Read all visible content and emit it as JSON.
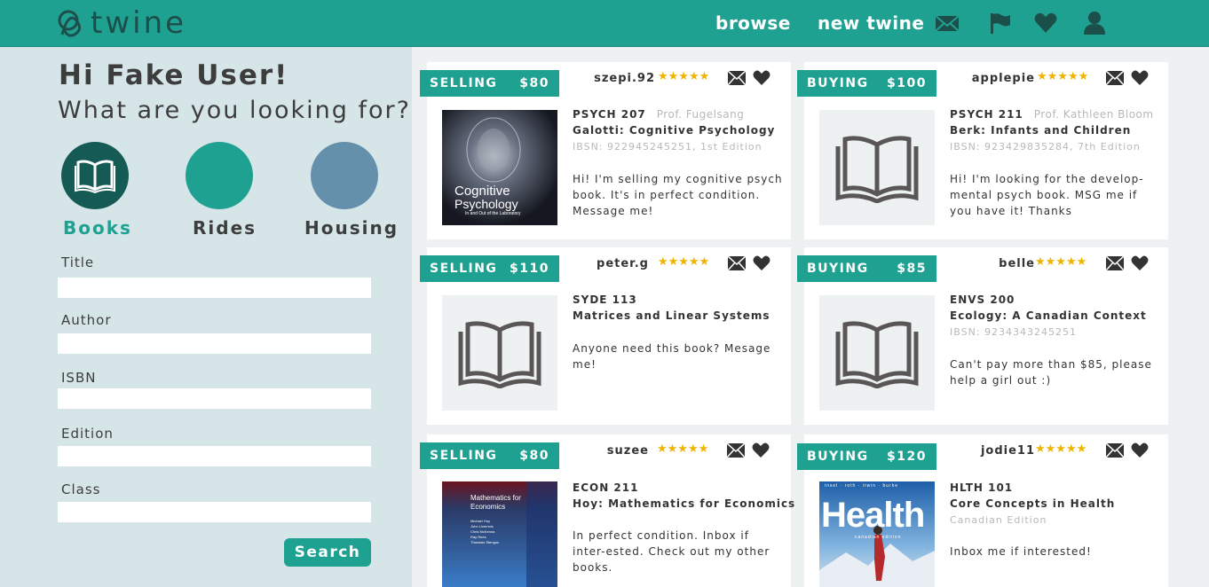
{
  "header": {
    "logo_text": "twine",
    "nav": {
      "browse": "browse",
      "new_twine": "new twine"
    },
    "icons": [
      "mail-icon",
      "flag-icon",
      "heart-icon",
      "user-icon"
    ]
  },
  "sidebar": {
    "greeting": "Hi Fake User!",
    "question": "What are you looking for?",
    "categories": [
      {
        "label": "Books",
        "color": "#155a55",
        "active": true
      },
      {
        "label": "Rides",
        "color": "#1fa192",
        "active": false
      },
      {
        "label": "Housing",
        "color": "#6590ac",
        "active": false
      }
    ],
    "fields": [
      {
        "label": "Title",
        "value": ""
      },
      {
        "label": "Author",
        "value": ""
      },
      {
        "label": "ISBN",
        "value": ""
      },
      {
        "label": "Edition",
        "value": ""
      },
      {
        "label": "Class",
        "value": ""
      }
    ],
    "search_label": "Search"
  },
  "colors": {
    "brand": "#1fa192",
    "brand_dark": "#155a55",
    "star": "#f0b400",
    "sidebar_bg": "#d6e6e8"
  },
  "listings": [
    {
      "type": "SELLING",
      "price": "$80",
      "user": "szepi.92",
      "stars": "★★★★★",
      "course": "PSYCH 207",
      "prof": "Prof. Fugelsang",
      "title": "Galotti: Cognitive Psychology",
      "isbn": "IBSN: 922945245251, 1st Edition",
      "desc": "Hi! I'm selling my cognitive psych book. It's in perfect condition. Message me!",
      "image": "cover-cognitive-psychology"
    },
    {
      "type": "BUYING",
      "price": "$100",
      "user": "applepie",
      "stars": "★★★★★",
      "course": "PSYCH 211",
      "prof": "Prof. Kathleen Bloom",
      "title": "Berk: Infants and Children",
      "isbn": "IBSN: 923429835284, 7th Edition",
      "desc": "Hi! I'm looking for the develop-mental psych book. MSG me if you have it! Thanks",
      "image": "book-placeholder-icon"
    },
    {
      "type": "SELLING",
      "price": "$110",
      "user": "peter.g",
      "stars": "★★★★★",
      "course": "SYDE 113",
      "prof": "",
      "title": "Matrices and Linear Systems",
      "isbn": "",
      "desc": "Anyone need this book? Mesage me!",
      "image": "book-placeholder-icon"
    },
    {
      "type": "BUYING",
      "price": "$85",
      "user": "belle",
      "stars": "★★★★★",
      "course": "ENVS 200",
      "prof": "",
      "title": "Ecology: A Canadian Context",
      "isbn": "IBSN: 9234343245251",
      "desc": "Can't pay more than $85, please help a girl out :)",
      "image": "book-placeholder-icon"
    },
    {
      "type": "SELLING",
      "price": "$80",
      "user": "suzee",
      "stars": "★★★★★",
      "course": "ECON 211",
      "prof": "",
      "title": "Hoy: Mathematics for Economics",
      "isbn": "",
      "desc": "In perfect condition. Inbox if inter-ested. Check out my other books.",
      "image": "cover-mathematics-for-economics"
    },
    {
      "type": "BUYING",
      "price": "$120",
      "user": "jodie11",
      "stars": "★★★★★",
      "course": "HLTH 101",
      "prof": "",
      "title": "Core Concepts in Health",
      "isbn": "Canadian Edition",
      "desc": "Inbox me if interested!",
      "image": "cover-health"
    }
  ],
  "covers": {
    "cognitive": {
      "title_line1": "Cognitive",
      "title_line2": "Psychology",
      "subtitle": "In and Out of the Laboratory"
    },
    "math": {
      "title": "Mathematics for Economics",
      "authors": [
        "Michael Hoy",
        "John Livernois",
        "Chris McKenna",
        "Ray Rees",
        "Thanasis Stengos"
      ]
    },
    "health": {
      "authors": "insel · roth · irwin · burke",
      "title": "Health",
      "subtitle": "canadian edition"
    }
  }
}
